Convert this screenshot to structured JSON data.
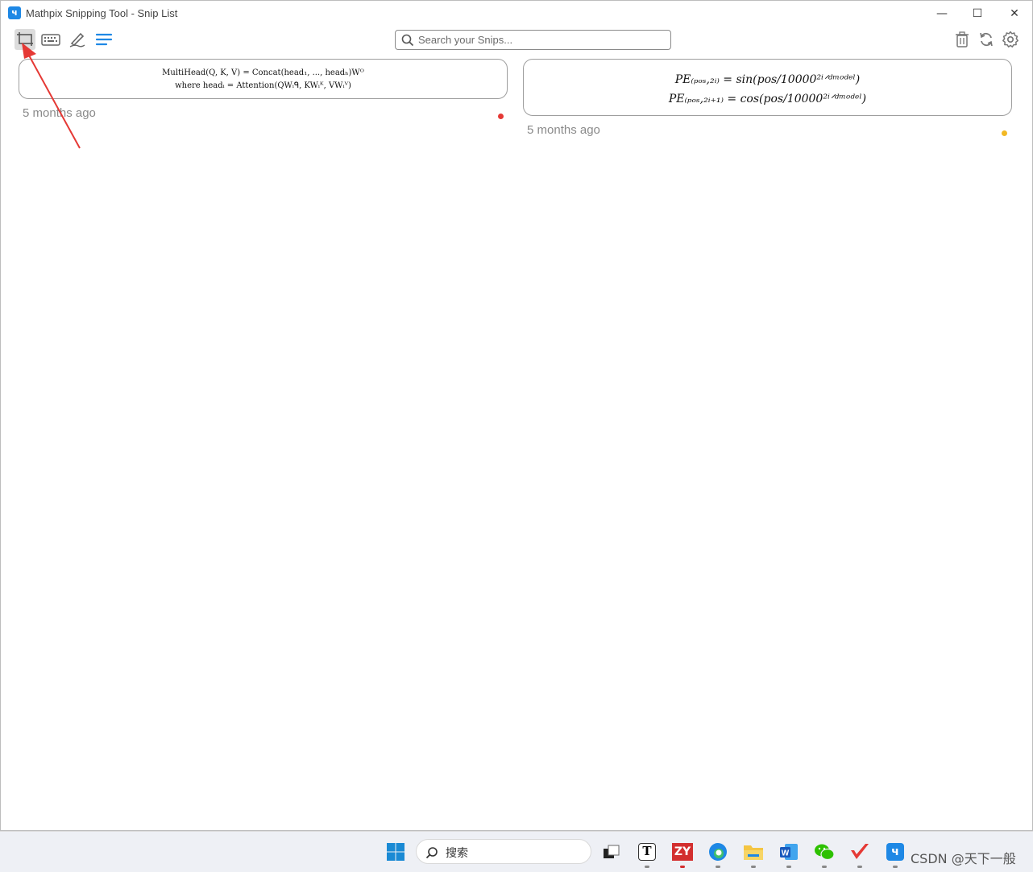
{
  "window": {
    "title": "Mathpix Snipping Tool - Snip List",
    "app_icon_glyph": "ч",
    "controls": {
      "minimize": "—",
      "maximize": "☐",
      "close": "✕"
    }
  },
  "toolbar": {
    "buttons": [
      {
        "name": "screenshot-snip-icon",
        "active": true
      },
      {
        "name": "keyboard-icon",
        "active": false
      },
      {
        "name": "handwriting-pen-icon",
        "active": false
      },
      {
        "name": "list-menu-icon",
        "active": false
      }
    ],
    "search_placeholder": "Search your Snips...",
    "right_buttons": [
      "trash-icon",
      "sync-icon",
      "settings-gear-icon"
    ]
  },
  "snips": [
    {
      "line1": "MultiHead(Q, K, V) = Concat(head₁, ..., headₕ)Wᴼ",
      "line2": "where headᵢ = Attention(QWᵢᑫ, KWᵢᴷ, VWᵢⱽ)",
      "time": "5 months ago",
      "dot_color": "#e53935"
    },
    {
      "line1": "PE₍ₚₒₛ,₂ᵢ₎ = sin(pos/10000²ⁱᐟᵈᵐᵒᵈᵉˡ)",
      "line2": "PE₍ₚₒₛ,₂ᵢ₊₁₎ = cos(pos/10000²ⁱᐟᵈᵐᵒᵈᵉˡ)",
      "time": "5 months ago",
      "dot_color": "#f2b824"
    }
  ],
  "taskbar": {
    "search_label": "搜索",
    "watermark": "CSDN @天下一般",
    "apps": [
      "windows-start-icon",
      "taskview-icon",
      "typora-T-icon",
      "zy-app-icon",
      "edge-icon",
      "file-explorer-icon",
      "word-icon",
      "wechat-icon",
      "red-check-app-icon",
      "mathpix-icon"
    ]
  },
  "colors": {
    "accent": "#1e88e5",
    "arrow": "#e53935"
  }
}
